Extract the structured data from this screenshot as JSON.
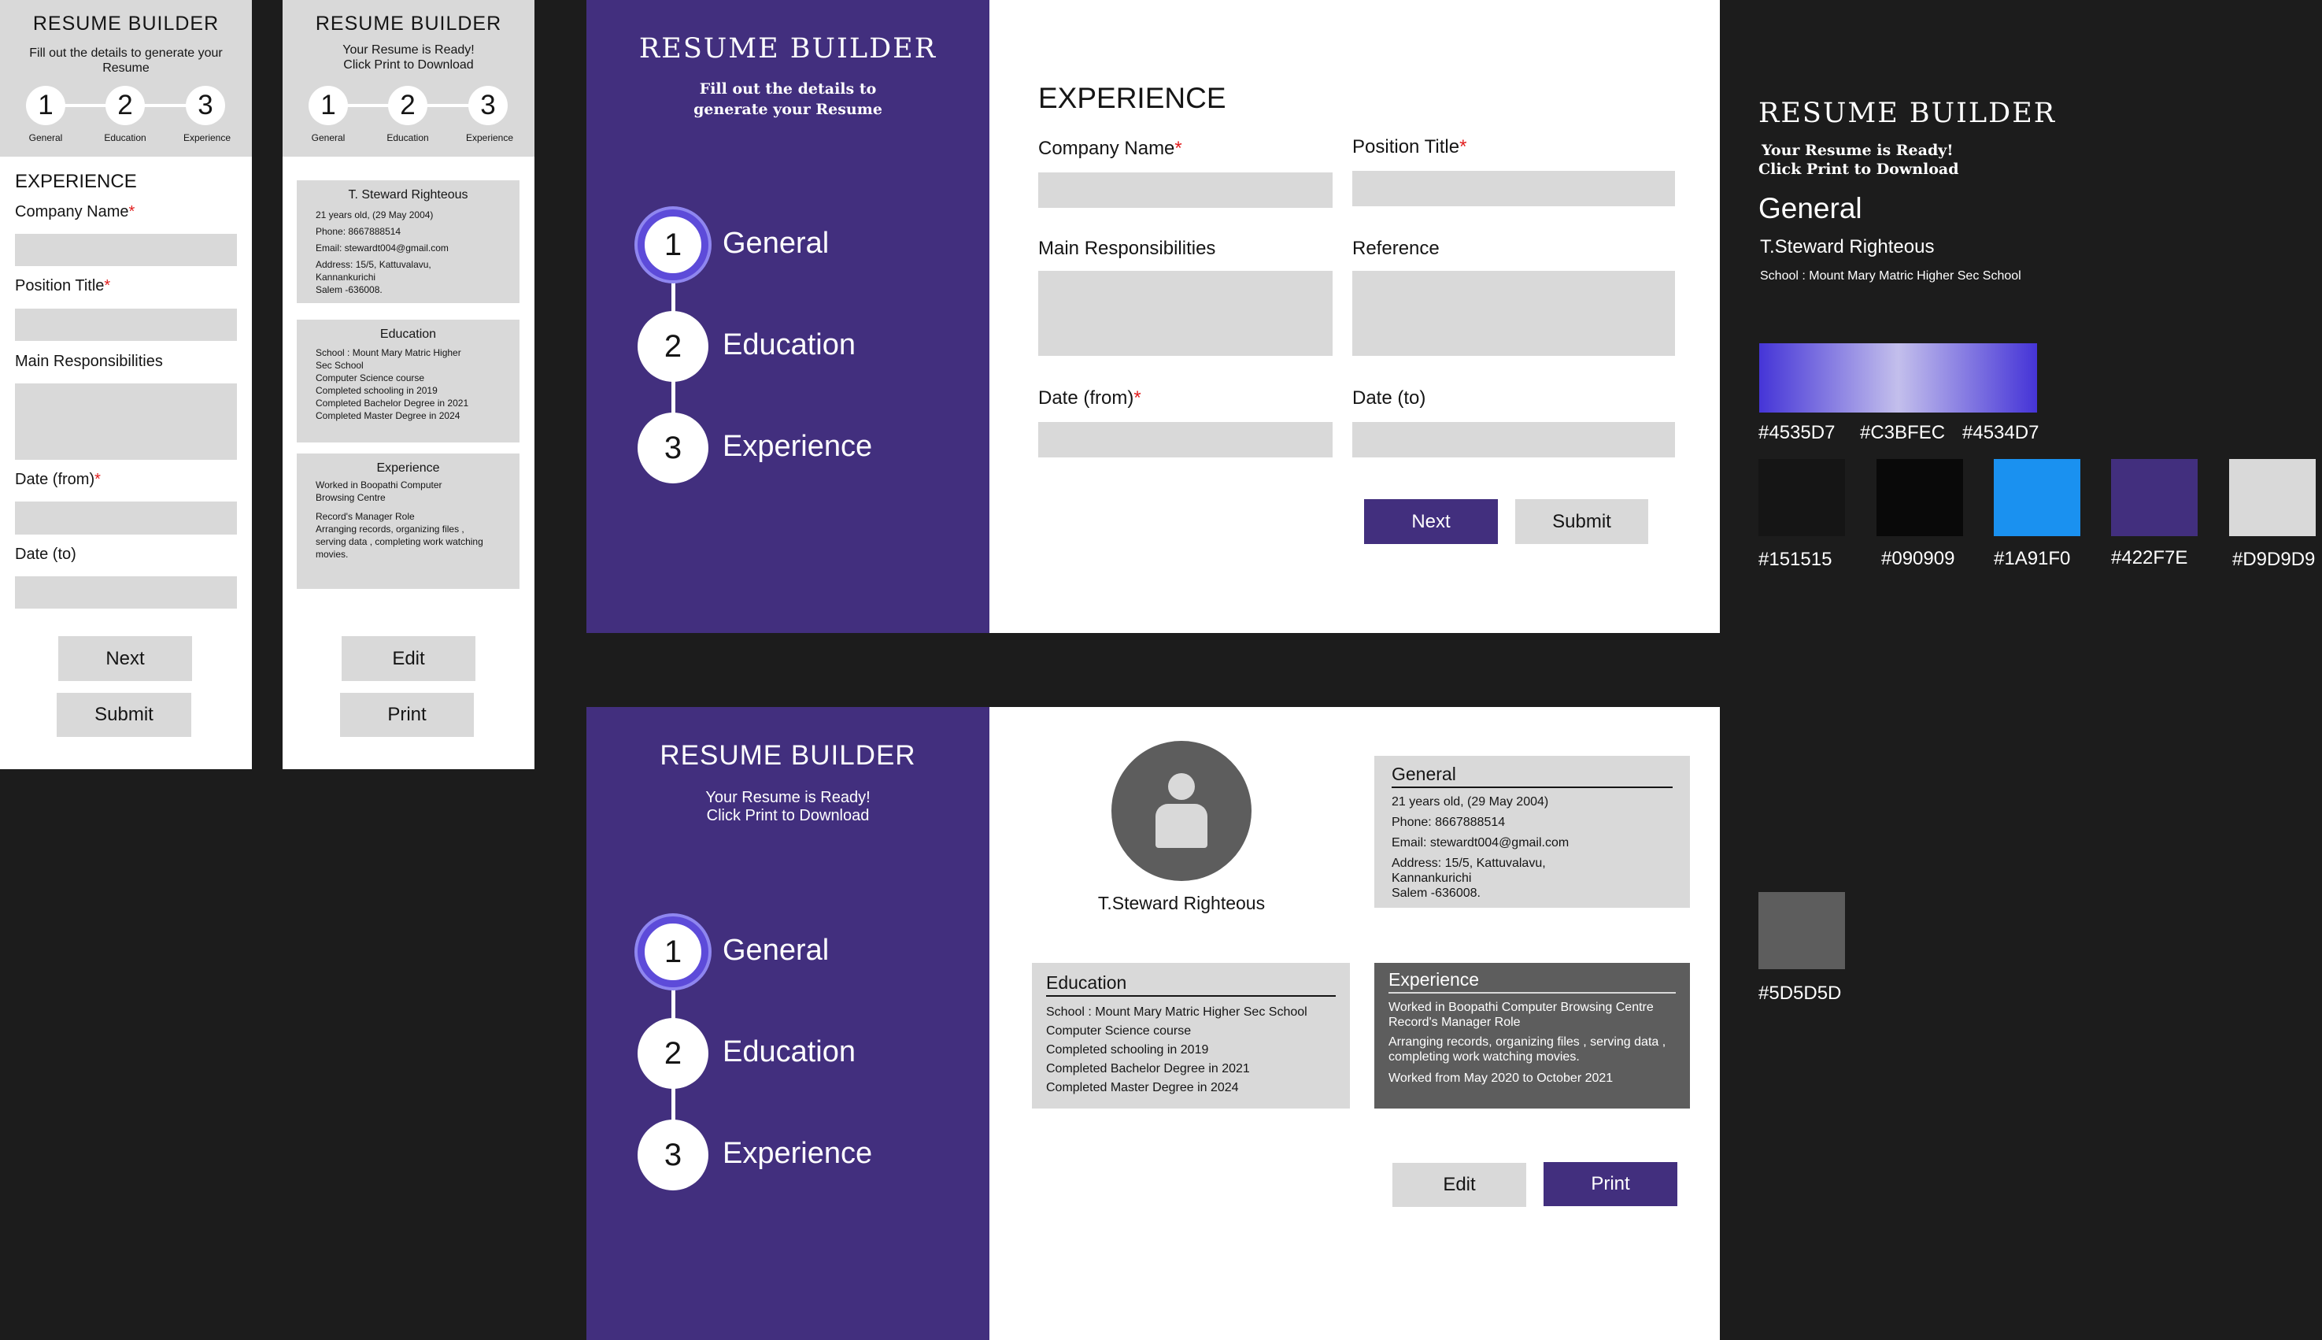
{
  "app_title": "RESUME BUILDER",
  "fill_subtitle": "Fill out the details to generate your Resume",
  "ready_line1": "Your Resume is Ready!",
  "ready_line2": "Click Print to Download",
  "steps": [
    {
      "num": "1",
      "label": "General"
    },
    {
      "num": "2",
      "label": "Education"
    },
    {
      "num": "3",
      "label": "Experience"
    }
  ],
  "experience_form": {
    "heading": "EXPERIENCE",
    "company_label": "Company Name",
    "position_label": "Position Title",
    "responsibilities_label": "Main Responsibilities",
    "reference_label": "Reference",
    "date_from_label": "Date (from)",
    "date_to_label": "Date (to)",
    "required_mark": "*",
    "next_label": "Next",
    "submit_label": "Submit"
  },
  "resume": {
    "name": "T.Steward Righteous",
    "name_mobile": "T. Steward Righteous",
    "general": {
      "title": "General",
      "lines": [
        "21 years old, (29 May 2004)",
        "Phone: 8667888514",
        "Email: stewardt004@gmail.com",
        "Address: 15/5, Kattuvalavu,",
        "Kannankurichi",
        "Salem -636008."
      ]
    },
    "education": {
      "title": "Education",
      "lines": [
        "School : Mount Mary Matric Higher Sec School",
        "Computer Science course",
        "Completed schooling in 2019",
        "Completed Bachelor Degree in 2021",
        "Completed Master Degree in 2024"
      ],
      "mobile_lines": [
        "School : Mount Mary Matric Higher",
        "Sec School",
        "Computer Science course",
        "Completed schooling in 2019",
        "Completed Bachelor Degree in 2021",
        "Completed Master Degree in 2024"
      ]
    },
    "experience": {
      "title": "Experience",
      "lines": [
        "Worked in Boopathi Computer Browsing Centre",
        "Record's Manager Role",
        "Arranging records, organizing files , serving data ,",
        "completing work watching movies.",
        "Worked from May 2020 to October 2021"
      ],
      "mobile_lines": [
        "Worked in Boopathi Computer",
        "Browsing Centre",
        "Record's Manager Role",
        "Arranging records, organizing files ,",
        "serving data , completing work watching",
        "movies."
      ]
    },
    "edit_label": "Edit",
    "print_label": "Print"
  },
  "style_guide": {
    "title": "RESUME BUILDER",
    "ready_line1": "Your Resume is Ready!",
    "ready_line2": "Click Print to Download",
    "heading_sample": "General",
    "name_sample": "T.Steward Righteous",
    "school_sample": "School : Mount Mary Matric Higher Sec School",
    "gradient_labels": [
      "#4535D7",
      "#C3BFEC",
      "#4534D7"
    ],
    "swatches": [
      "#151515",
      "#090909",
      "#1A91F0",
      "#422F7E",
      "#D9D9D9"
    ],
    "swatch_extra": "#5D5D5D"
  },
  "colors": {
    "purple": "#422f7e",
    "gray": "#d9d9d9",
    "dark_gray": "#5d5d5d",
    "blue": "#1a91f0",
    "background": "#1c1c1c"
  }
}
